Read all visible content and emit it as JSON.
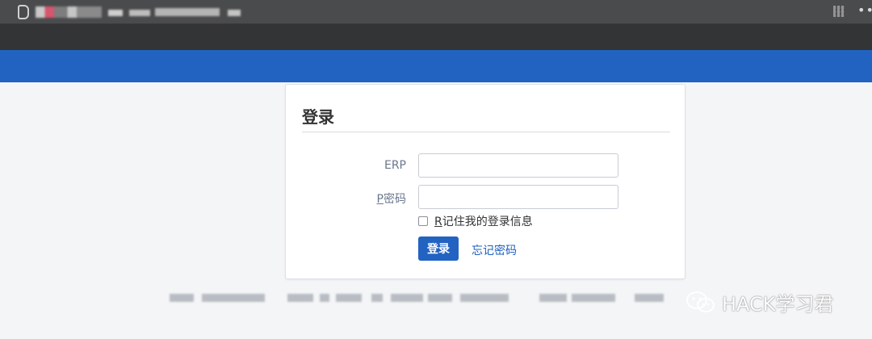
{
  "browser": {
    "tab_icon": "document-icon",
    "qr_icon": "qr-code-icon",
    "menu_label": "•••"
  },
  "login": {
    "title": "登录",
    "erp_label": "ERP",
    "password_label_key": "P",
    "password_label_rest": "密码",
    "erp_value": "",
    "password_value": "",
    "remember_key": "R",
    "remember_rest": "记住我的登录信息",
    "remember_checked": false,
    "submit_label": "登录",
    "forgot_label": "忘记密码"
  },
  "watermark": {
    "text": "HACK学习君",
    "icon": "wechat-icon"
  },
  "colors": {
    "header_blue": "#2263c2",
    "link_blue": "#1d5fbf",
    "chrome_dark": "#333436"
  }
}
